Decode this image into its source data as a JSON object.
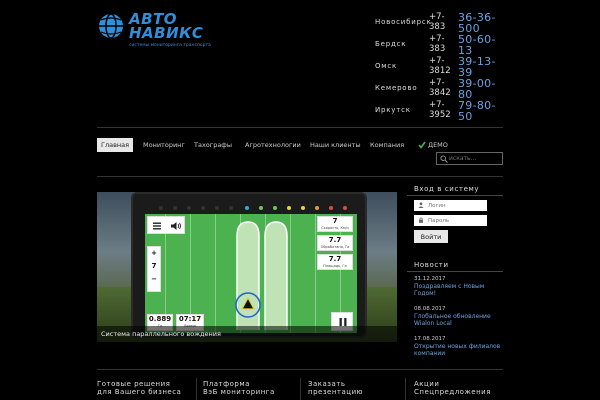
{
  "logo": {
    "line1": "АВТО",
    "line2": "НАВИКС",
    "tagline": "системы мониторинга транспорта",
    "color": "#2f8fd8"
  },
  "phones": [
    {
      "city": "Новосибирск",
      "code": "+7-383",
      "number": "36-36-500"
    },
    {
      "city": "Бердск",
      "code": "+7-383",
      "number": "50-60-13"
    },
    {
      "city": "Омск",
      "code": "+7-3812",
      "number": "39-13-39"
    },
    {
      "city": "Кемерово",
      "code": "+7-3842",
      "number": "39-00-80"
    },
    {
      "city": "Иркутск",
      "code": "+7-3952",
      "number": "79-80-50"
    }
  ],
  "nav": {
    "items": [
      "Главная",
      "Мониторинг",
      "Тахографы",
      "Агротехнологии",
      "Наши клиенты",
      "Компания",
      "ДЕМО"
    ],
    "active": "Главная",
    "search_placeholder": "искать..."
  },
  "banner": {
    "caption": "Система параллельного вождения",
    "screen": {
      "speed_value": "7",
      "speed_label": "Скорость, Км/ч",
      "area_value": "7.7",
      "area_label": "Обработано, Га",
      "field_value": "7.7",
      "field_label": "Площадь, Га",
      "zoom_plus": "+",
      "zoom_value": "7",
      "zoom_minus": "−",
      "stat1_value": "0.889",
      "stat1_label": "Га",
      "stat2_value": "07:17",
      "stat2_label": "Время"
    }
  },
  "login": {
    "title": "Вход в систему",
    "login_placeholder": "Логин",
    "password_placeholder": "Пароль",
    "button": "Войти"
  },
  "news": {
    "title": "Новости",
    "items": [
      {
        "date": "31.12.2017",
        "text": "Поздравляем с Новым Годом!"
      },
      {
        "date": "08.08.2017",
        "text": "Глобальное обновление Wialon Local"
      },
      {
        "date": "17.08.2017",
        "text": "Открытие новых филиалов компании"
      }
    ]
  },
  "bottom": [
    {
      "line1": "Готовые решения",
      "line2": "для Вашего бизнеса"
    },
    {
      "line1": "Платформа",
      "line2": "ВэБ мониторинга"
    },
    {
      "line1": "Заказать",
      "line2": "презентацию"
    },
    {
      "line1": "Акции",
      "line2": "Спецпредложения"
    }
  ]
}
